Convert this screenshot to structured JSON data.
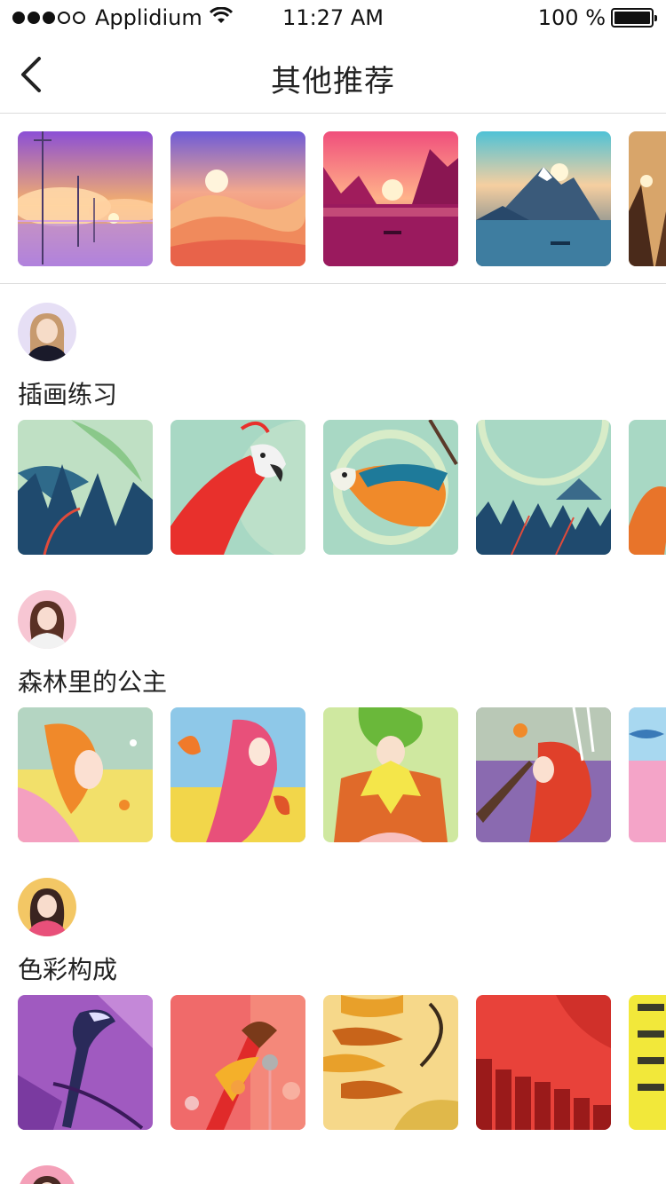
{
  "status": {
    "carrier": "Applidium",
    "time": "11:27 AM",
    "battery": "100 %"
  },
  "nav": {
    "title": "其他推荐",
    "back_icon": "chevron-left-icon"
  },
  "sections": [
    {
      "title": "插画练习",
      "avatar_color": "#e6dff5"
    },
    {
      "title": "森林里的公主",
      "avatar_color": "#f7c6d3"
    },
    {
      "title": "色彩构成",
      "avatar_color": "#f3c765"
    }
  ],
  "colors": {
    "divider": "#dcdcdc",
    "text": "#222222"
  }
}
